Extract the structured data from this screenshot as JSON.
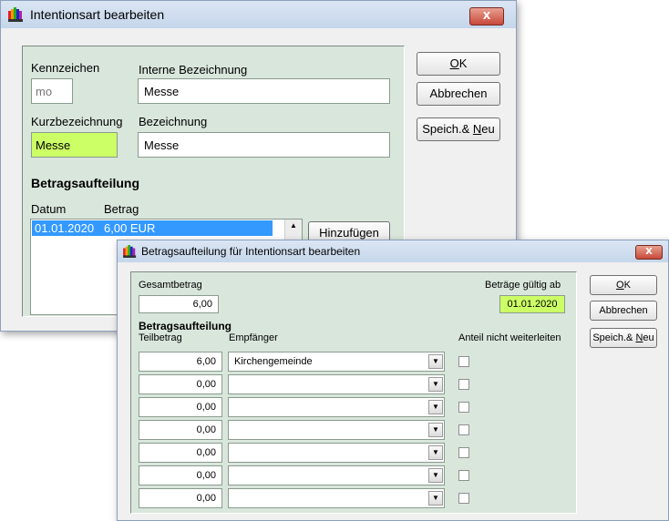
{
  "dialog1": {
    "title": "Intentionsart bearbeiten",
    "close_label": "X",
    "labels": {
      "kennzeichen": "Kennzeichen",
      "interne_bezeichnung": "Interne Bezeichnung",
      "kurzbezeichnung": "Kurzbezeichnung",
      "bezeichnung": "Bezeichnung",
      "section": "Betragsaufteilung",
      "col_datum": "Datum",
      "col_betrag": "Betrag"
    },
    "values": {
      "kennzeichen": "mo",
      "interne_bezeichnung": "Messe",
      "kurzbezeichnung": "Messe",
      "bezeichnung": "Messe"
    },
    "list_rows": [
      {
        "datum": "01.01.2020",
        "betrag": "6,00 EUR"
      }
    ],
    "buttons": {
      "ok_u": "O",
      "ok_rest": "K",
      "abbrechen": "Abbrechen",
      "speich_pre": "Speich.& ",
      "speich_u": "N",
      "speich_post": "eu",
      "hinzufuegen": "Hinzufügen"
    },
    "colors": {
      "highlight_field": "#ccff66",
      "selected_row": "#3399ff"
    }
  },
  "dialog2": {
    "title": "Betragsaufteilung für Intentionsart bearbeiten",
    "close_label": "X",
    "labels": {
      "gesamtbetrag": "Gesamtbetrag",
      "gueltig_ab": "Beträge gültig ab",
      "section": "Betragsaufteilung",
      "col_teilbetrag": "Teilbetrag",
      "col_empfaenger": "Empfänger",
      "col_anteil": "Anteil nicht weiterleiten"
    },
    "values": {
      "gesamtbetrag": "6,00",
      "gueltig_ab": "01.01.2020"
    },
    "rows": [
      {
        "teilbetrag": "6,00",
        "empfaenger": "Kirchengemeinde"
      },
      {
        "teilbetrag": "0,00",
        "empfaenger": ""
      },
      {
        "teilbetrag": "0,00",
        "empfaenger": ""
      },
      {
        "teilbetrag": "0,00",
        "empfaenger": ""
      },
      {
        "teilbetrag": "0,00",
        "empfaenger": ""
      },
      {
        "teilbetrag": "0,00",
        "empfaenger": ""
      },
      {
        "teilbetrag": "0,00",
        "empfaenger": ""
      }
    ],
    "buttons": {
      "ok_u": "O",
      "ok_rest": "K",
      "abbrechen": "Abbrechen",
      "speich_pre": "Speich.& ",
      "speich_u": "N",
      "speich_post": "eu"
    }
  }
}
